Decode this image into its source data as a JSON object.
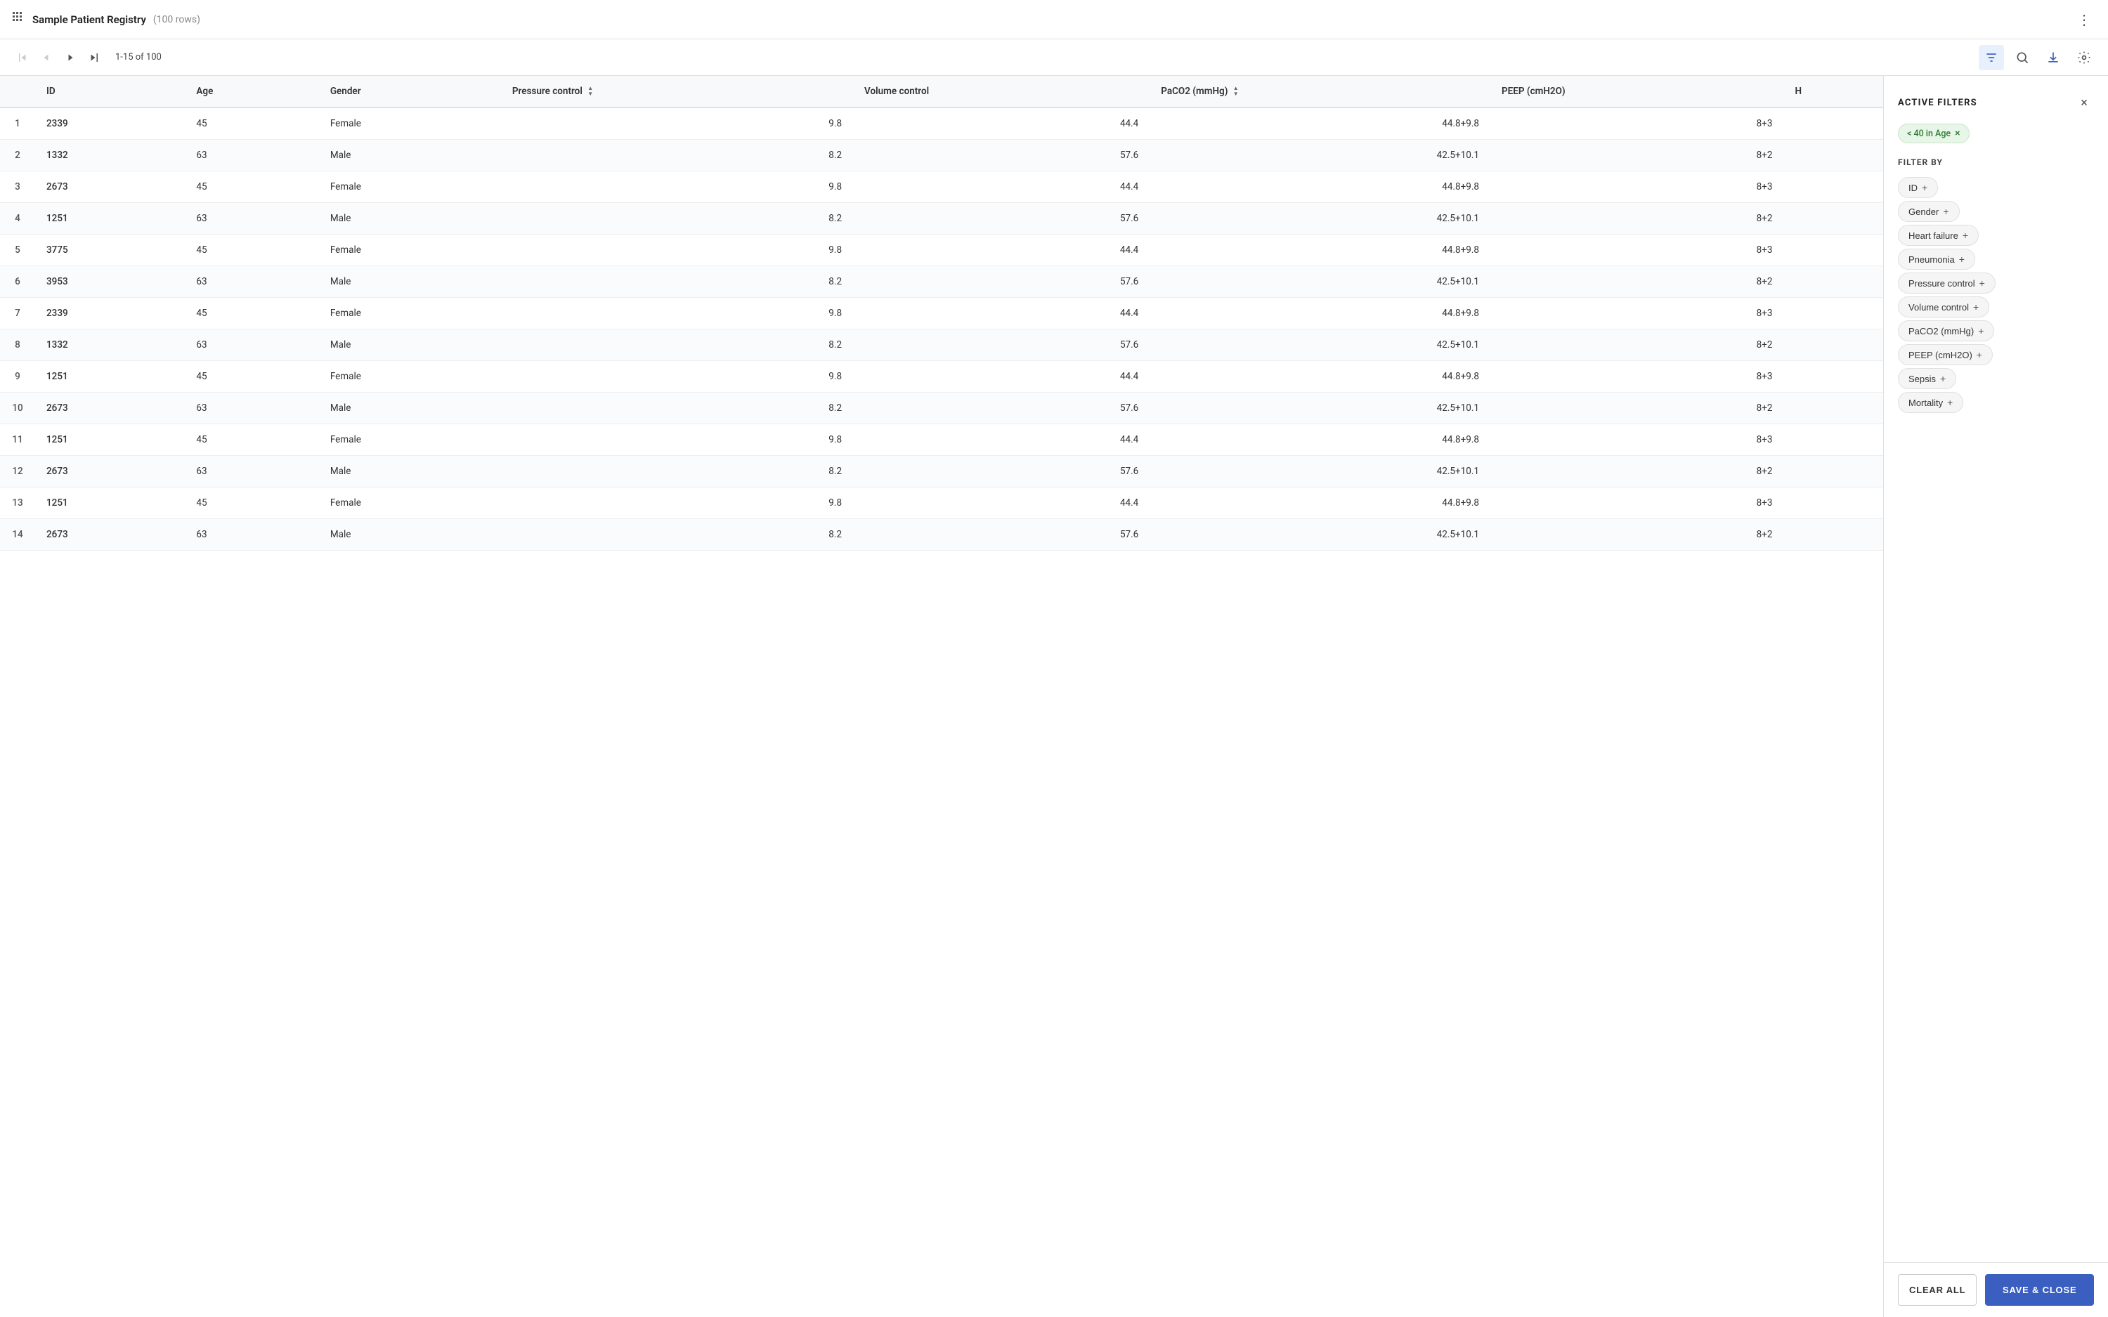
{
  "header": {
    "title": "Sample Patient Registry",
    "row_count": "(100 rows)",
    "kebab_label": "⋮"
  },
  "pagination": {
    "info": "1-15 of 100",
    "first_btn": "⟨|",
    "prev_btn": "‹",
    "next_btn": "›",
    "last_btn": "|⟩"
  },
  "toolbar": {
    "filter_tooltip": "Filter",
    "search_tooltip": "Search",
    "download_tooltip": "Download",
    "settings_tooltip": "Settings"
  },
  "table": {
    "columns": [
      "",
      "ID",
      "Age",
      "Gender",
      "Pressure control",
      "Volume control",
      "PaCO2 (mmHg)",
      "PEEP (cmH2O)",
      "H"
    ],
    "rows": [
      {
        "row_num": "1",
        "id": "2339",
        "age": "45",
        "gender": "Female",
        "pressure": "9.8",
        "volume": "44.4",
        "paco2": "44.8+9.8",
        "peep": "8+3"
      },
      {
        "row_num": "2",
        "id": "1332",
        "age": "63",
        "gender": "Male",
        "pressure": "8.2",
        "volume": "57.6",
        "paco2": "42.5+10.1",
        "peep": "8+2"
      },
      {
        "row_num": "3",
        "id": "2673",
        "age": "45",
        "gender": "Female",
        "pressure": "9.8",
        "volume": "44.4",
        "paco2": "44.8+9.8",
        "peep": "8+3"
      },
      {
        "row_num": "4",
        "id": "1251",
        "age": "63",
        "gender": "Male",
        "pressure": "8.2",
        "volume": "57.6",
        "paco2": "42.5+10.1",
        "peep": "8+2"
      },
      {
        "row_num": "5",
        "id": "3775",
        "age": "45",
        "gender": "Female",
        "pressure": "9.8",
        "volume": "44.4",
        "paco2": "44.8+9.8",
        "peep": "8+3"
      },
      {
        "row_num": "6",
        "id": "3953",
        "age": "63",
        "gender": "Male",
        "pressure": "8.2",
        "volume": "57.6",
        "paco2": "42.5+10.1",
        "peep": "8+2"
      },
      {
        "row_num": "7",
        "id": "2339",
        "age": "45",
        "gender": "Female",
        "pressure": "9.8",
        "volume": "44.4",
        "paco2": "44.8+9.8",
        "peep": "8+3"
      },
      {
        "row_num": "8",
        "id": "1332",
        "age": "63",
        "gender": "Male",
        "pressure": "8.2",
        "volume": "57.6",
        "paco2": "42.5+10.1",
        "peep": "8+2"
      },
      {
        "row_num": "9",
        "id": "1251",
        "age": "45",
        "gender": "Female",
        "pressure": "9.8",
        "volume": "44.4",
        "paco2": "44.8+9.8",
        "peep": "8+3"
      },
      {
        "row_num": "10",
        "id": "2673",
        "age": "63",
        "gender": "Male",
        "pressure": "8.2",
        "volume": "57.6",
        "paco2": "42.5+10.1",
        "peep": "8+2"
      },
      {
        "row_num": "11",
        "id": "1251",
        "age": "45",
        "gender": "Female",
        "pressure": "9.8",
        "volume": "44.4",
        "paco2": "44.8+9.8",
        "peep": "8+3"
      },
      {
        "row_num": "12",
        "id": "2673",
        "age": "63",
        "gender": "Male",
        "pressure": "8.2",
        "volume": "57.6",
        "paco2": "42.5+10.1",
        "peep": "8+2"
      },
      {
        "row_num": "13",
        "id": "1251",
        "age": "45",
        "gender": "Female",
        "pressure": "9.8",
        "volume": "44.4",
        "paco2": "44.8+9.8",
        "peep": "8+3"
      },
      {
        "row_num": "14",
        "id": "2673",
        "age": "63",
        "gender": "Male",
        "pressure": "8.2",
        "volume": "57.6",
        "paco2": "42.5+10.1",
        "peep": "8+2"
      }
    ]
  },
  "filter_panel": {
    "title": "ACTIVE FILTERS",
    "close_btn": "×",
    "active_filters": [
      {
        "label": "< 40 in Age",
        "removable": true
      }
    ],
    "filter_by_label": "FILTER BY",
    "filter_options": [
      {
        "label": "ID"
      },
      {
        "label": "Gender"
      },
      {
        "label": "Heart failure"
      },
      {
        "label": "Pneumonia"
      },
      {
        "label": "Pressure control"
      },
      {
        "label": "Volume control"
      },
      {
        "label": "PaCO2 (mmHg)"
      },
      {
        "label": "PEEP (cmH2O)"
      },
      {
        "label": "Sepsis"
      },
      {
        "label": "Mortality"
      }
    ],
    "clear_all_label": "CLEAR ALL",
    "save_close_label": "SAVE & CLOSE"
  }
}
